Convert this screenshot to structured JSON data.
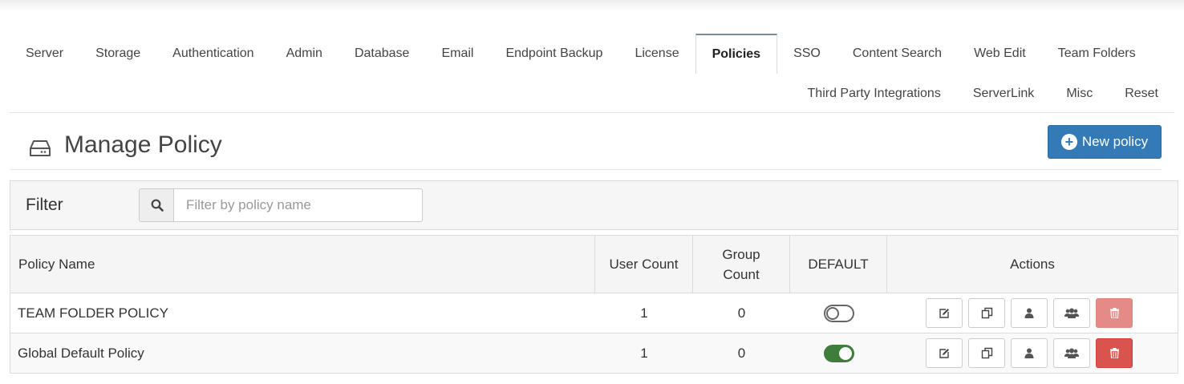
{
  "tabs_row1": [
    "Server",
    "Storage",
    "Authentication",
    "Admin",
    "Database",
    "Email",
    "Endpoint Backup",
    "License",
    "Policies",
    "SSO",
    "Content Search",
    "Web Edit",
    "Team Folders"
  ],
  "tabs_row2": [
    "Third Party Integrations",
    "ServerLink",
    "Misc",
    "Reset"
  ],
  "active_tab": "Policies",
  "header": {
    "title": "Manage Policy",
    "icon": "hard-drive-icon",
    "new_button_label": "New policy"
  },
  "filter": {
    "label": "Filter",
    "placeholder": "Filter by policy name",
    "value": ""
  },
  "table": {
    "columns": {
      "name": "Policy Name",
      "user_count": "User Count",
      "group_count_1": "Group",
      "group_count_2": "Count",
      "default": "DEFAULT",
      "actions": "Actions"
    },
    "rows": [
      {
        "name": "TEAM FOLDER POLICY",
        "user_count": "1",
        "group_count": "0",
        "default": false
      },
      {
        "name": "Global Default Policy",
        "user_count": "1",
        "group_count": "0",
        "default": true
      }
    ]
  },
  "colors": {
    "primary": "#337ab7",
    "danger": "#d9534f",
    "toggle_on": "#3f7d3a"
  }
}
